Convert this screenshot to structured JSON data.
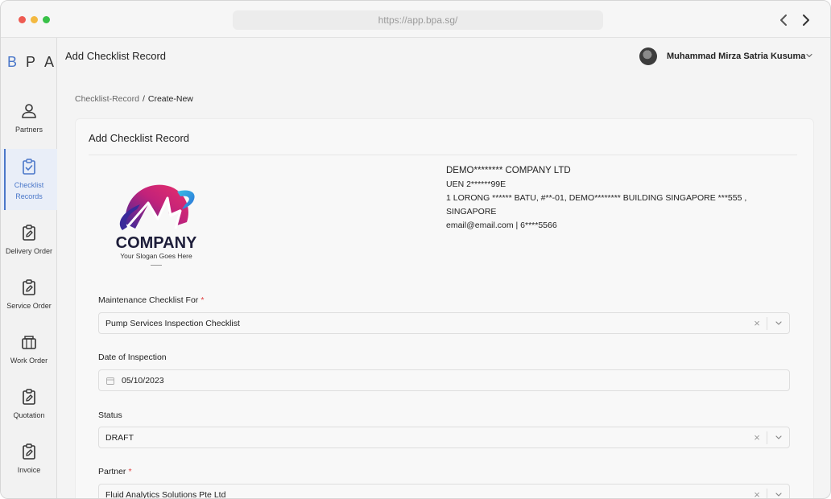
{
  "browser": {
    "url": "https://app.bpa.sg/"
  },
  "brand": {
    "letters": [
      "B",
      "P",
      "A"
    ]
  },
  "sidebar": {
    "items": [
      {
        "label": "Partners",
        "icon": "person-icon"
      },
      {
        "label": "Checklist\nRecords",
        "label_line1": "Checklist",
        "label_line2": "Records",
        "icon": "clipboard-check-icon",
        "active": true
      },
      {
        "label": "Delivery Order",
        "icon": "clipboard-edit-icon"
      },
      {
        "label": "Service Order",
        "icon": "clipboard-edit-icon"
      },
      {
        "label": "Work Order",
        "icon": "briefcase-icon"
      },
      {
        "label": "Quotation",
        "icon": "clipboard-edit-icon"
      },
      {
        "label": "Invoice",
        "icon": "clipboard-edit-icon"
      }
    ]
  },
  "header": {
    "title": "Add Checklist Record",
    "user_name": "Muhammad Mirza Satria Kusuma"
  },
  "breadcrumb": {
    "parent": "Checklist-Record",
    "separator": "/",
    "current": "Create-New"
  },
  "card": {
    "title": "Add Checklist Record",
    "logo": {
      "text": "COMPANY",
      "slogan": "Your Slogan Goes Here"
    },
    "company": {
      "name": "DEMO******** COMPANY LTD",
      "uen": "UEN 2******99E",
      "address_line1": "1 LORONG ****** BATU, #**-01, DEMO******** BUILDING SINGAPORE ***555 ,",
      "address_line2": "SINGAPORE",
      "contact": "email@email.com | 6****5566"
    },
    "fields": {
      "checklist_for": {
        "label": "Maintenance Checklist For",
        "required_mark": "*",
        "value": "Pump Services Inspection Checklist"
      },
      "date": {
        "label": "Date of Inspection",
        "value": "05/10/2023"
      },
      "status": {
        "label": "Status",
        "value": "DRAFT"
      },
      "partner": {
        "label": "Partner",
        "required_mark": "*",
        "value": "Fluid Analytics Solutions Pte Ltd"
      }
    }
  },
  "colors": {
    "accent": "#4a77c9",
    "required": "#e04040"
  }
}
